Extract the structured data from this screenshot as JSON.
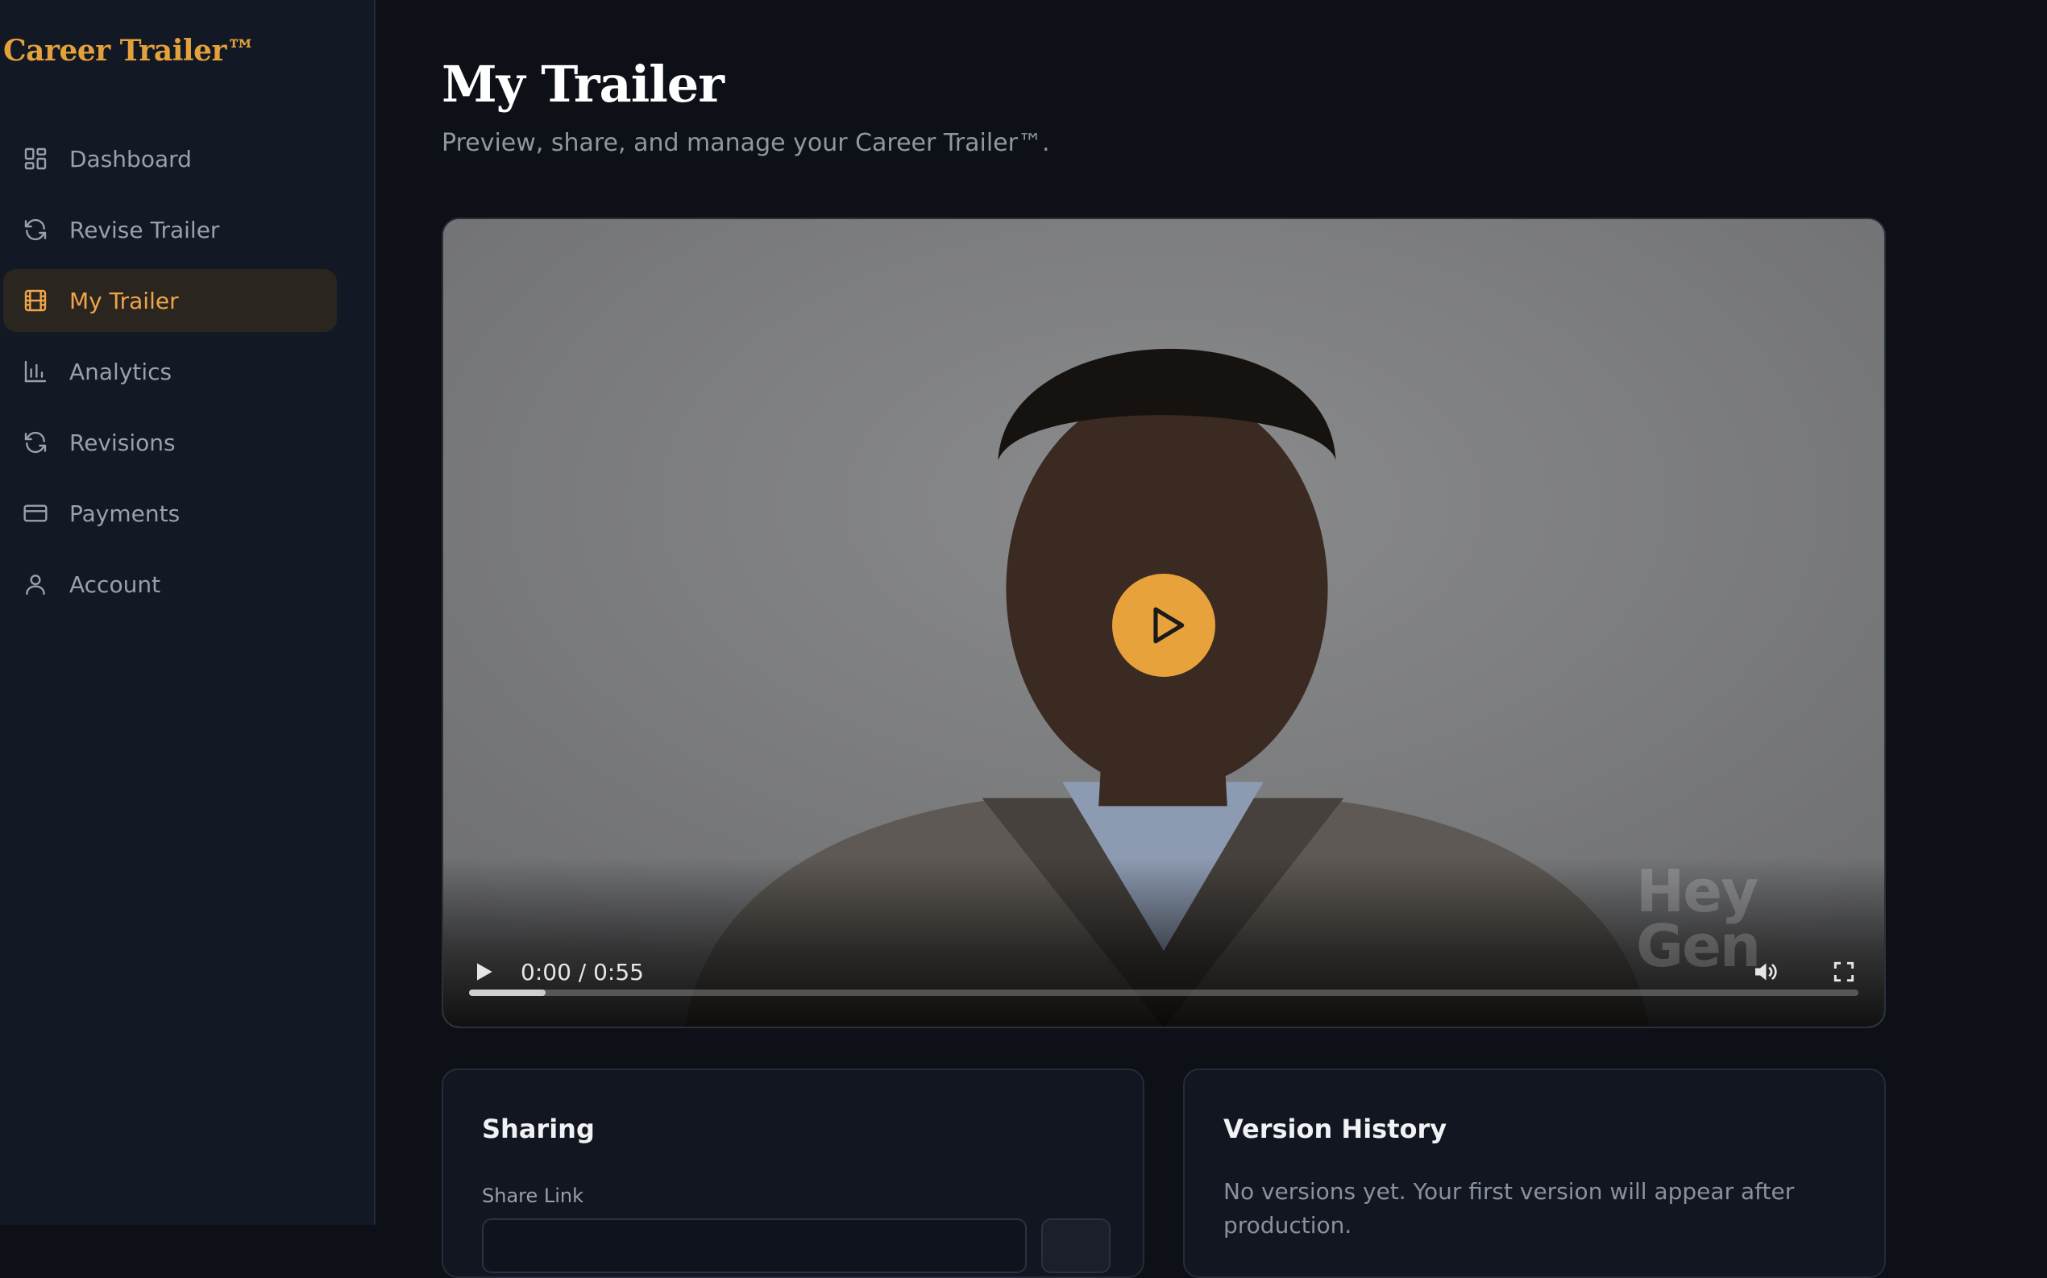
{
  "brand": "Career Trailer™",
  "nav": [
    {
      "label": "Dashboard",
      "icon": "dashboard-icon"
    },
    {
      "label": "Revise Trailer",
      "icon": "refresh-icon"
    },
    {
      "label": "My Trailer",
      "icon": "film-icon",
      "active": true
    },
    {
      "label": "Analytics",
      "icon": "bar-chart-icon"
    },
    {
      "label": "Revisions",
      "icon": "refresh-icon"
    },
    {
      "label": "Payments",
      "icon": "credit-card-icon"
    },
    {
      "label": "Account",
      "icon": "user-icon"
    }
  ],
  "page": {
    "title": "My Trailer",
    "subtitle": "Preview, share, and manage your Career Trailer™."
  },
  "video": {
    "time": "0:00 / 0:55",
    "progress": 0.055,
    "watermark": "Hey Gen"
  },
  "sharing": {
    "title": "Sharing",
    "share_link_label": "Share Link"
  },
  "version_history": {
    "title": "Version History",
    "empty_text": "No versions yet. Your first version will appear after production."
  },
  "colors": {
    "accent": "#e8a23c",
    "background": "#0d1017",
    "sidebar": "#121824"
  }
}
